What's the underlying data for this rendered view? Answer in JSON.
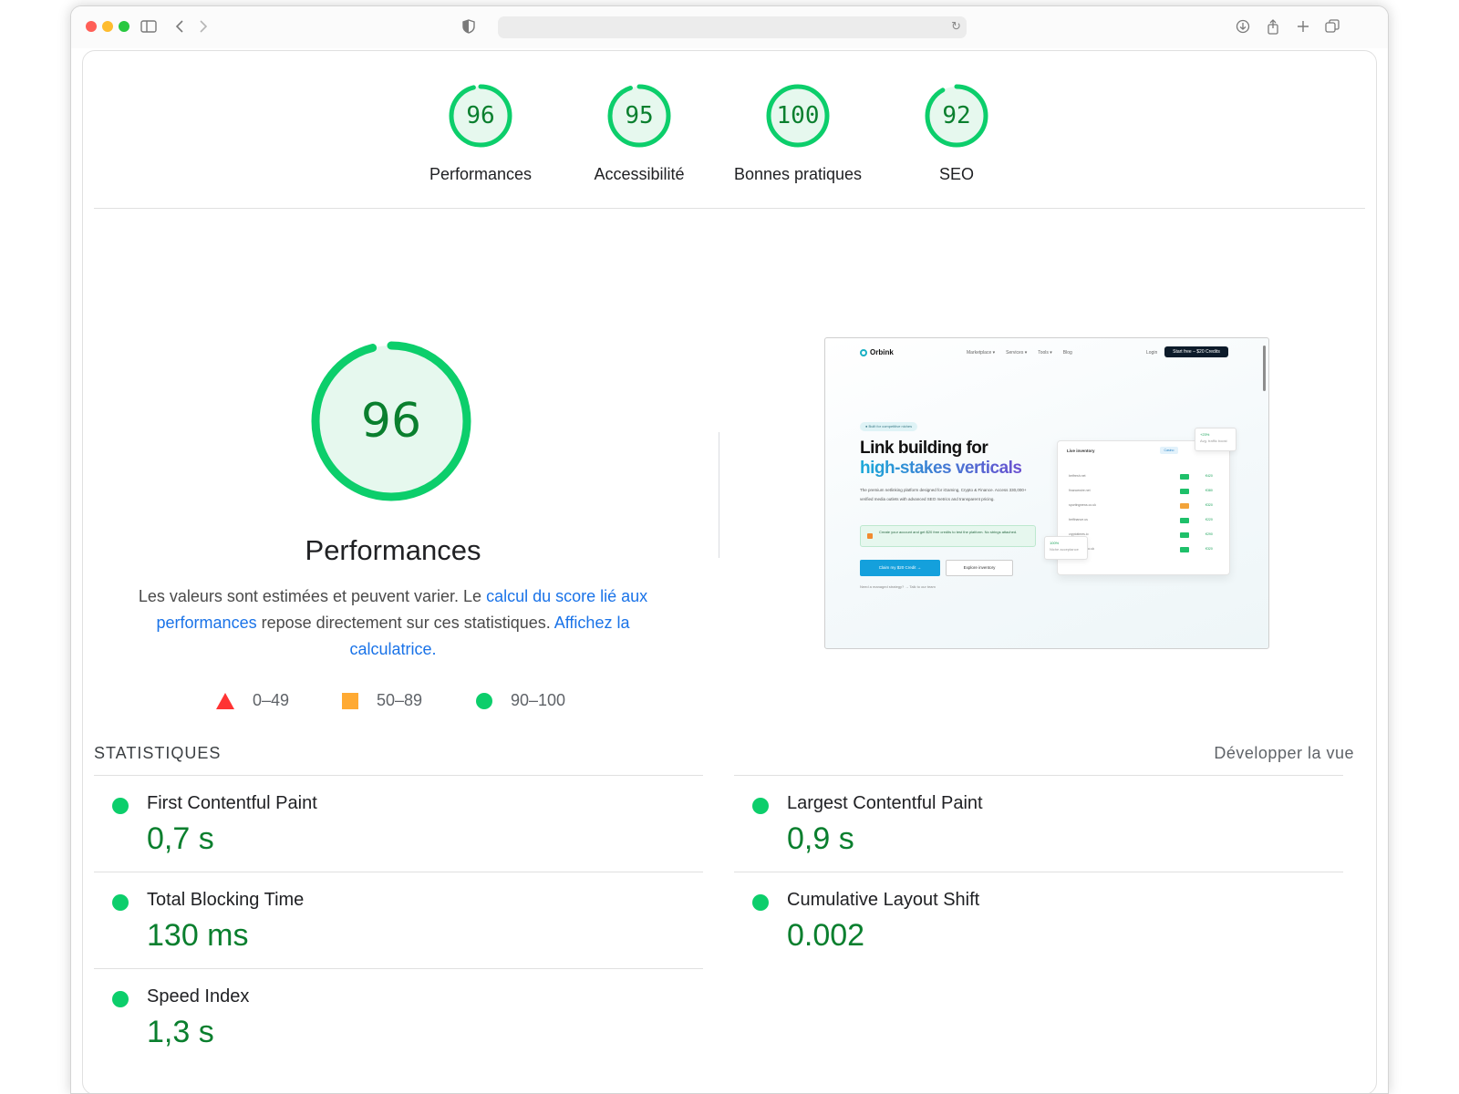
{
  "browser": {
    "icons": [
      "sidebar-icon",
      "back-icon",
      "forward-icon",
      "shield-icon",
      "reload-icon",
      "download-icon",
      "share-icon",
      "new-tab-icon",
      "tabs-overview-icon"
    ]
  },
  "categories": [
    {
      "label": "Performances",
      "score": "96",
      "value": 0.96
    },
    {
      "label": "Accessibilité",
      "score": "95",
      "value": 0.95
    },
    {
      "label": "Bonnes pratiques",
      "score": "100",
      "value": 1.0
    },
    {
      "label": "SEO",
      "score": "92",
      "value": 0.92
    }
  ],
  "main": {
    "score": "96",
    "value": 0.96,
    "title": "Performances",
    "desc_part1": "Les valeurs sont estimées et peuvent varier. Le ",
    "desc_link1": "calcul du score lié aux performances",
    "desc_part2": " repose directement sur ces statistiques. ",
    "desc_link2": "Affichez la calculatrice."
  },
  "legend": [
    {
      "range": "0–49",
      "shape": "triangle",
      "color": "#ff3333"
    },
    {
      "range": "50–89",
      "shape": "square",
      "color": "#ffaa33"
    },
    {
      "range": "90–100",
      "shape": "circle",
      "color": "#0cce6b"
    }
  ],
  "screenshot": {
    "logo": "Orbink",
    "nav": [
      "Marketplace ▾",
      "Services ▾",
      "Tools ▾",
      "Blog"
    ],
    "login": "Login",
    "cta": "Start free – $20 Credits",
    "pill": "● Built for competitive niches",
    "headline_line1": "Link building for",
    "headline_line2": "high-stakes verticals",
    "paragraph": "The premium netlinking platform designed for iGaming, Crypto & Finance. Access 330,000+ verified media outlets with advanced SEO metrics and transparent pricing.",
    "note": "Create your account and get $20 free credits to test the platform. No strings attached.",
    "button_primary": "Claim my $20 Credit →",
    "button_secondary": "Explore inventory",
    "small_text": "Need a managed strategy? → Talk to our team",
    "card_title": "Live inventory",
    "card_tab": "Casino",
    "card_rows": [
      {
        "domain": "betfresh.net",
        "badge_color": "#1ec06a",
        "price": "€420"
      },
      {
        "domain": "financewire.net",
        "badge_color": "#1ec06a",
        "price": "€380"
      },
      {
        "domain": "sportingnews.co.uk",
        "badge_color": "#f2a33a",
        "price": "€320"
      },
      {
        "domain": "betfinance.us",
        "badge_color": "#1ec06a",
        "price": "€220"
      },
      {
        "domain": "cryptotimes.io",
        "badge_color": "#1ec06a",
        "price": "€290"
      },
      {
        "domain": "moneyweek.co.uk",
        "badge_color": "#1ec06a",
        "price": "€320"
      }
    ],
    "float1_value": "+23%",
    "float1_label": "Avg. traffic boost",
    "float2_value": "100%",
    "float2_label": "Niche acceptance"
  },
  "stats": {
    "header": "STATISTIQUES",
    "expand": "Développer la vue",
    "metrics": [
      {
        "name": "First Contentful Paint",
        "value": "0,7 s",
        "color": "#0cce6b"
      },
      {
        "name": "Largest Contentful Paint",
        "value": "0,9 s",
        "color": "#0cce6b"
      },
      {
        "name": "Total Blocking Time",
        "value": "130 ms",
        "color": "#0cce6b"
      },
      {
        "name": "Cumulative Layout Shift",
        "value": "0.002",
        "color": "#0cce6b"
      },
      {
        "name": "Speed Index",
        "value": "1,3 s",
        "color": "#0cce6b"
      }
    ]
  },
  "colors": {
    "pass": "#0cce6b",
    "pass_text": "#0a7f2e",
    "pass_fill": "#e6f8ee",
    "link": "#1a73e8"
  }
}
